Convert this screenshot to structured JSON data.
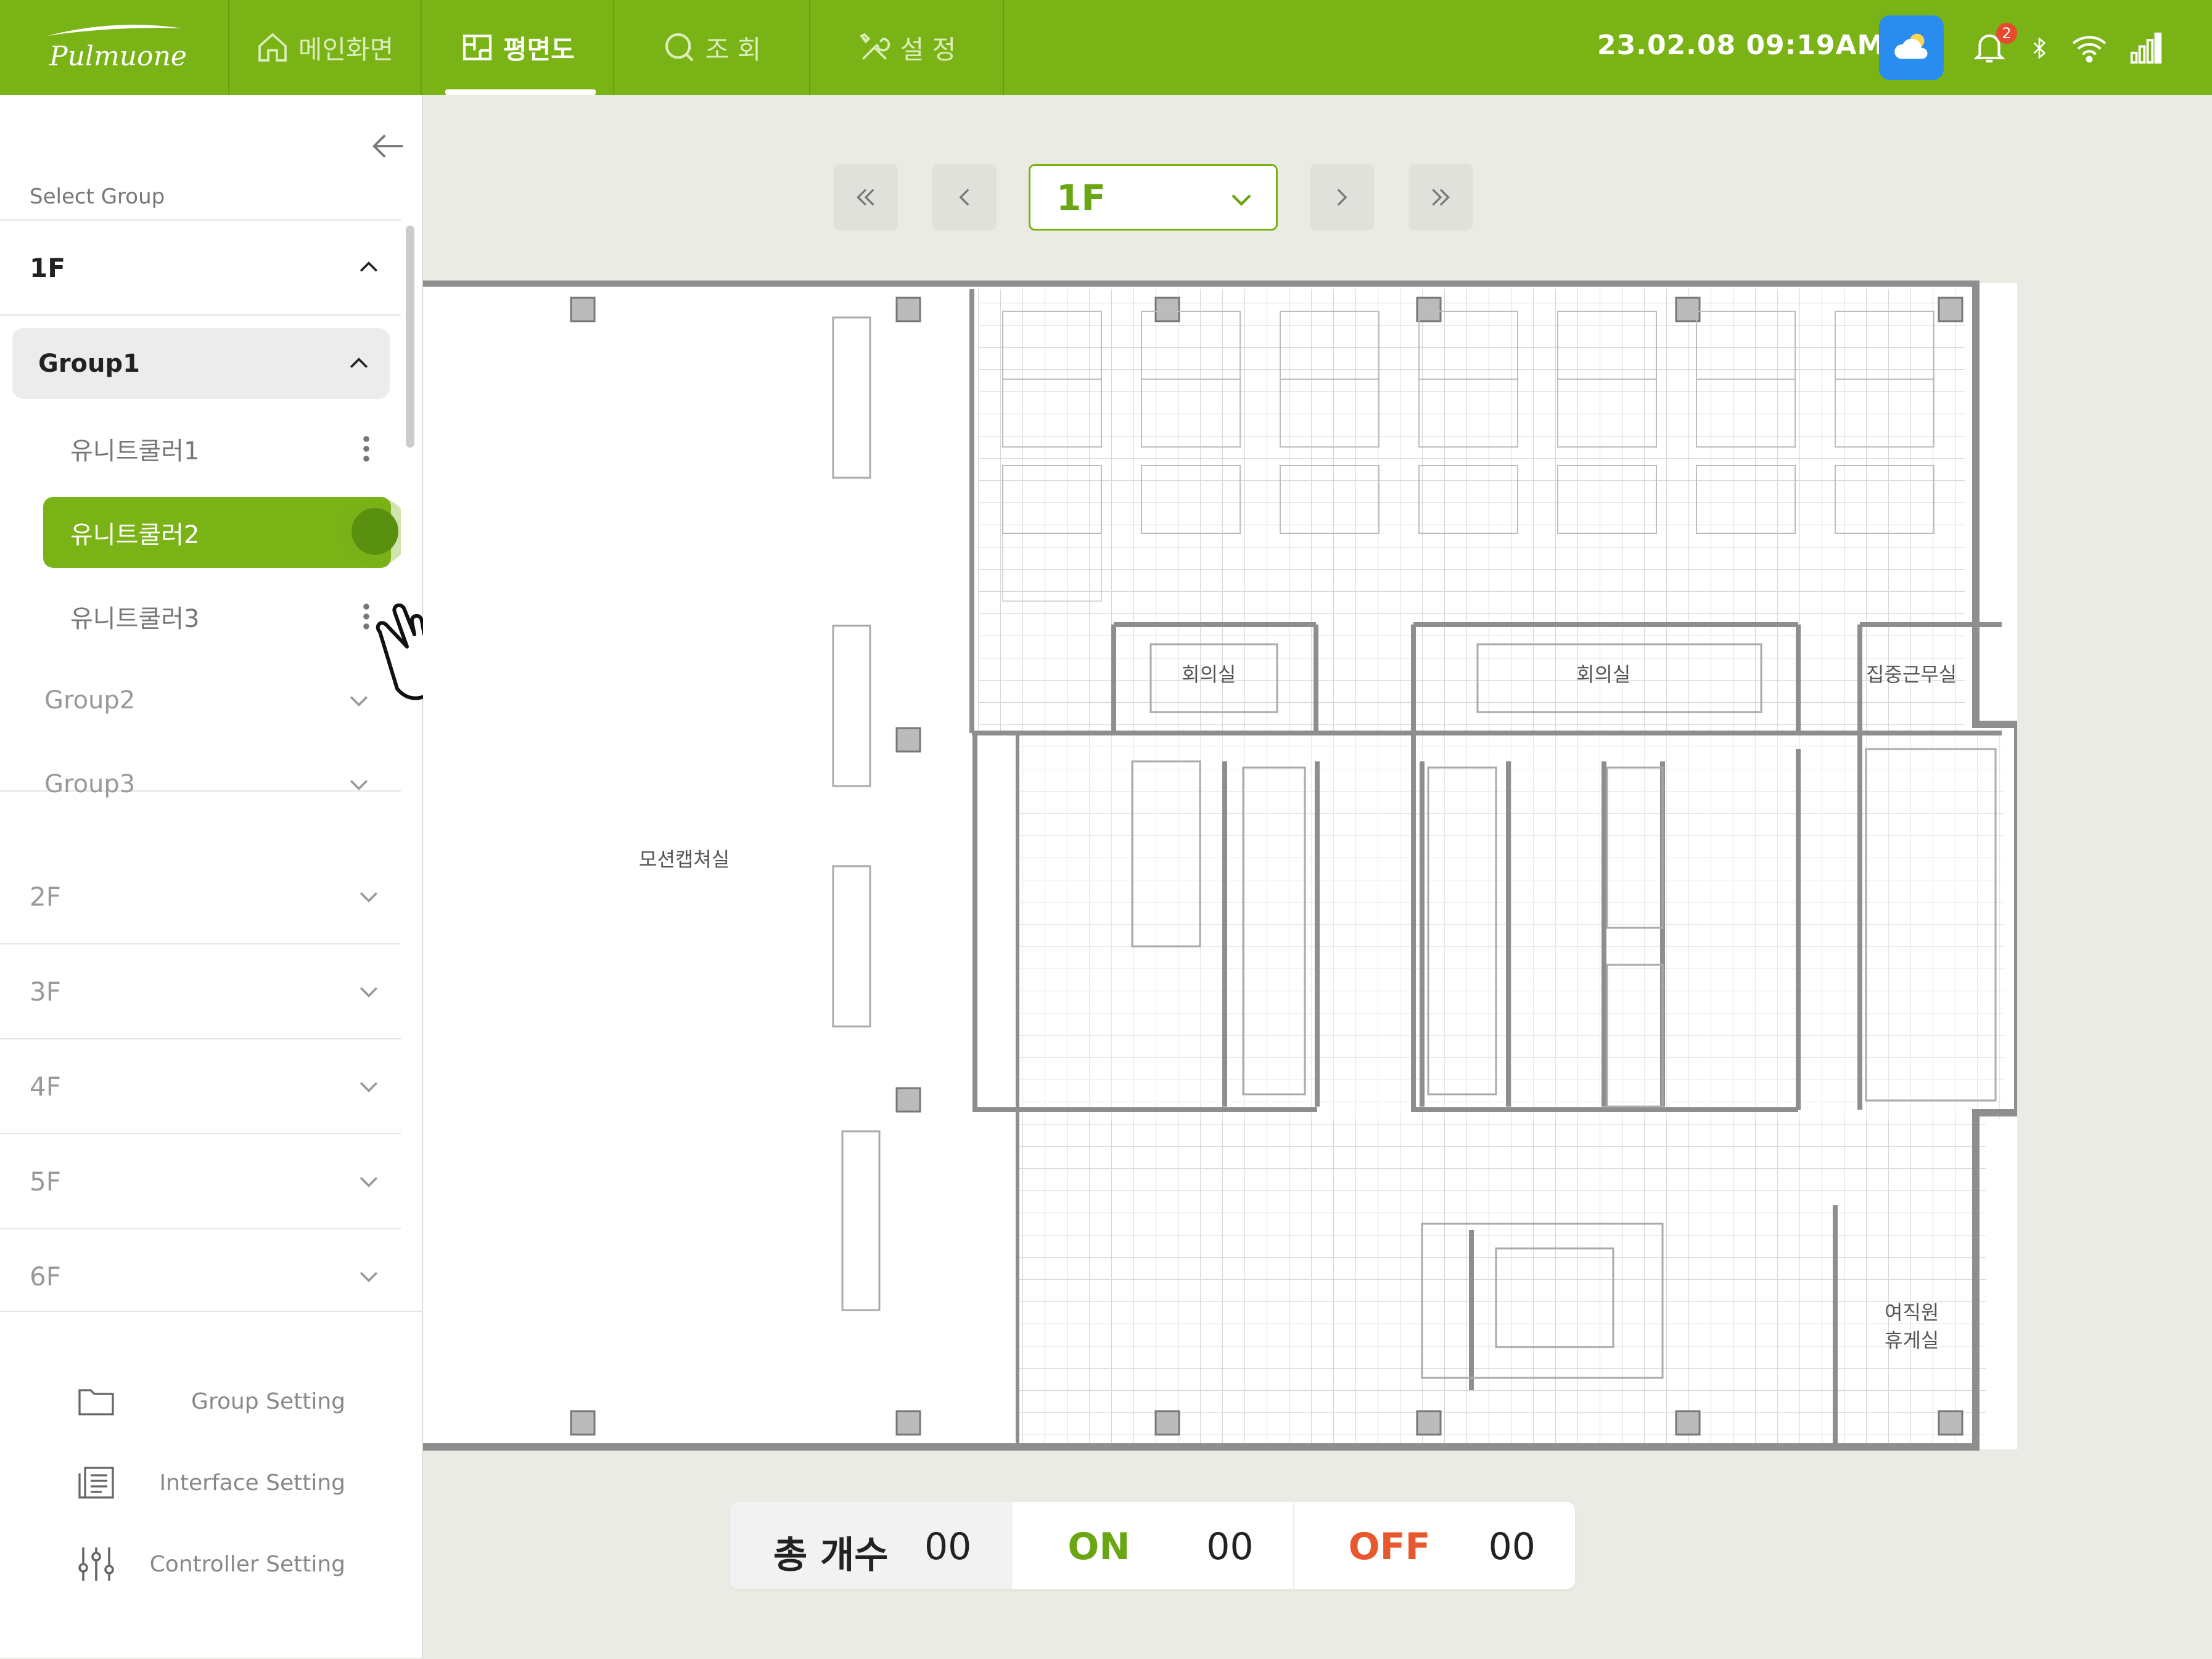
{
  "colors": {
    "brand": "#79b316",
    "brand_text": "#6aa614",
    "on": "#6aa614",
    "off": "#e8582f",
    "badge": "#e8492f",
    "weather_bg": "#2b8cf0"
  },
  "app": {
    "logo_text": "Pulmuone"
  },
  "nav": {
    "items": [
      {
        "label": "메인화면",
        "icon": "home-icon"
      },
      {
        "label": "평면도",
        "icon": "floorplan-icon"
      },
      {
        "label": "조 회",
        "icon": "search-icon"
      },
      {
        "label": "설 정",
        "icon": "tools-icon"
      }
    ],
    "active_index": 1
  },
  "status": {
    "datetime": "23.02.08  09:19AM",
    "notification_count": "2",
    "weather_icon": "cloud-sun-icon"
  },
  "sidebar": {
    "select_group_label": "Select Group",
    "floors": [
      {
        "label": "1F",
        "expanded": true,
        "groups": [
          {
            "label": "Group1",
            "expanded": true,
            "units": [
              {
                "label": "유니트쿨러1",
                "selected": false
              },
              {
                "label": "유니트쿨러2",
                "selected": true
              },
              {
                "label": "유니트쿨러3",
                "selected": false
              }
            ]
          },
          {
            "label": "Group2",
            "expanded": false
          },
          {
            "label": "Group3",
            "expanded": false
          }
        ]
      },
      {
        "label": "2F",
        "expanded": false
      },
      {
        "label": "3F",
        "expanded": false
      },
      {
        "label": "4F",
        "expanded": false
      },
      {
        "label": "5F",
        "expanded": false
      },
      {
        "label": "6F",
        "expanded": false
      }
    ],
    "settings": [
      {
        "label": "Group Setting",
        "icon": "folder-icon"
      },
      {
        "label": "Interface Setting",
        "icon": "list-document-icon"
      },
      {
        "label": "Controller Setting",
        "icon": "sliders-icon"
      }
    ]
  },
  "floor_selector": {
    "value": "1F"
  },
  "floorplan": {
    "rooms": {
      "motion_capture": "모션캡쳐실",
      "meeting_room_1": "회의실",
      "meeting_room_2": "회의실",
      "focus_room": "집중근무실",
      "lounge_line1": "여직원",
      "lounge_line2": "휴게실"
    }
  },
  "summary": {
    "total_label": "총 개수",
    "total_value": "00",
    "on_label": "ON",
    "on_value": "00",
    "off_label": "OFF",
    "off_value": "00"
  }
}
